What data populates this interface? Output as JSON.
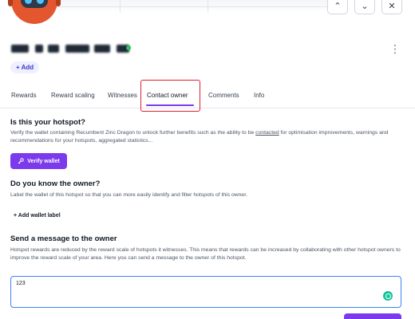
{
  "header": {
    "add_label": "+ Add",
    "nav": {
      "up_glyph": "⌃",
      "down_glyph": "⌄",
      "close_glyph": "✕"
    },
    "more_glyph": "⋮"
  },
  "tabs": [
    {
      "label": "Rewards"
    },
    {
      "label": "Reward scaling"
    },
    {
      "label": "Witnesses"
    },
    {
      "label": "Contact owner"
    },
    {
      "label": "Comments"
    },
    {
      "label": "Info"
    }
  ],
  "sections": {
    "hotspot": {
      "title": "Is this your hotspot?",
      "desc_part1": "Verify the wallet containing Recumbent Zinc Dragon to unlock further benefits such as the ability to be ",
      "desc_link": "contacted",
      "desc_part2": " for optimisation improvements, warnings and recommendations for your hotspots, aggregated statistics...",
      "verify_label": "Verify wallet"
    },
    "owner": {
      "title": "Do you know the owner?",
      "desc": "Label the wallet of this hotspot so that you can more easily identify and filter hotspots of this owner.",
      "add_label": "+ Add wallet label"
    },
    "message": {
      "title": "Send a message to the owner",
      "desc": "Hotspot rewards are reduced by the reward scale of hotspots it witnesses. This means that rewards can be increased by collaborating with other hotspot owners to improve the reward scale of your area. Here you can send a message to the owner of this hotspot.",
      "input_value": "123"
    }
  },
  "colors": {
    "accent": "#7c3aed",
    "highlight": "#e11d2e",
    "online": "#22c55e",
    "focus": "#3b82f6"
  }
}
